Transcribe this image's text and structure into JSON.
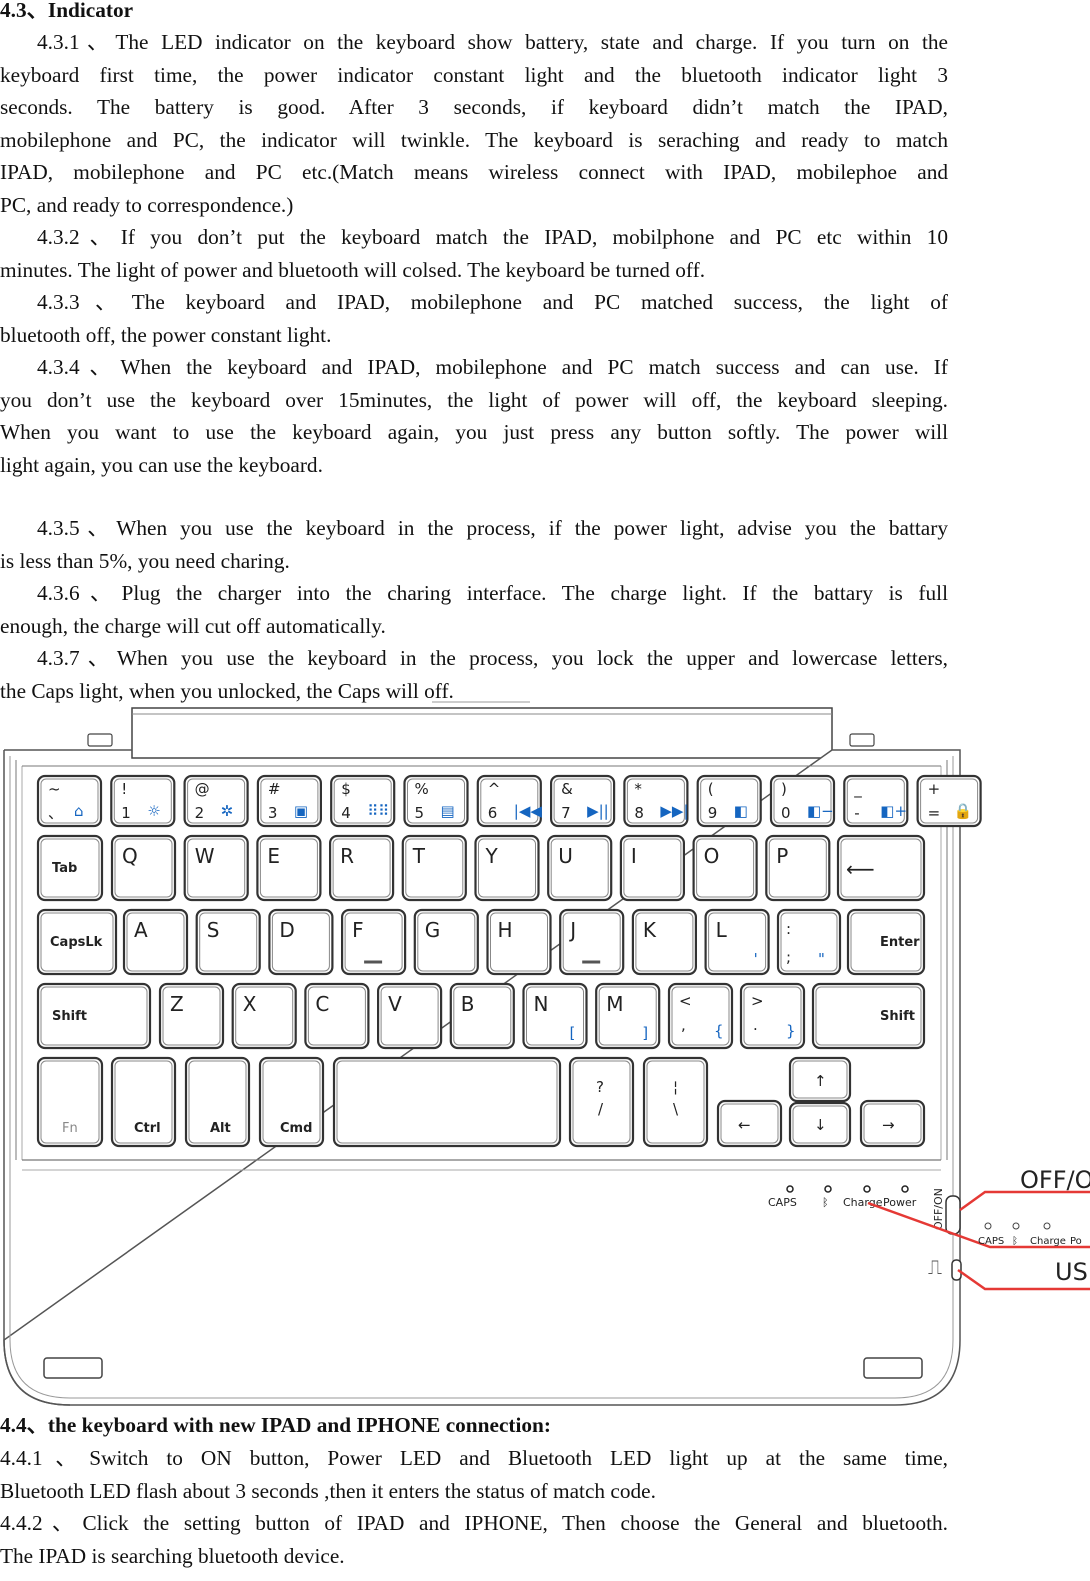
{
  "section_43": {
    "heading": "4.3、Indicator",
    "p431": [
      "4.3.1、The LED indicator on the keyboard show battery, state and charge. If you turn on the",
      "keyboard first time, the power indicator constant light and the bluetooth indicator light 3",
      "seconds. The battery is good. After 3 seconds, if keyboard didn’t match the IPAD,",
      "mobilephone and PC, the indicator will twinkle. The keyboard is seraching and ready to match",
      "IPAD, mobilephone and PC etc.(Match means wireless connect with IPAD, mobilephoe and",
      "PC, and ready to correspondence.)"
    ],
    "p432": [
      "4.3.2、If you don’t put the keyboard match the IPAD, mobilphone and PC etc within 10",
      "minutes. The light of power and bluetooth will colsed. The keyboard be turned off."
    ],
    "p433": [
      "4.3.3、The keyboard and IPAD, mobilephone and PC matched success, the light of",
      "bluetooth off, the power constant light."
    ],
    "p434": [
      "4.3.4、When the keyboard and IPAD, mobilephone and PC match success and can use. If",
      "you don’t use the keyboard over 15minutes, the light of power will off, the keyboard sleeping.",
      "When you want to use the keyboard again, you just press any button softly. The power will",
      "light again, you can use the keyboard."
    ],
    "p435": [
      "4.3.5、When you use the keyboard in the process, if the power light, advise you the battary",
      "is less than 5%, you need charing."
    ],
    "p436": [
      "4.3.6、Plug the charger into the charing interface. The charge light. If the battary is full",
      "enough, the charge will cut off automatically."
    ],
    "p437": [
      "4.3.7、When you use the keyboard in the process, you lock the upper and lowercase letters,",
      "the Caps light, when you unlocked, the Caps will off."
    ]
  },
  "figure": {
    "row1": [
      {
        "top": "~",
        "bottom": "、",
        "icon": "home-icon"
      },
      {
        "top": "!",
        "bottom": "1",
        "icon": "brightness-down-icon"
      },
      {
        "top": "@",
        "bottom": "2",
        "icon": "brightness-up-icon"
      },
      {
        "top": "#",
        "bottom": "3",
        "icon": "contacts-icon"
      },
      {
        "top": "$",
        "bottom": "4",
        "icon": "virtual-keyboard-icon"
      },
      {
        "top": "%",
        "bottom": "5",
        "icon": "search-icon"
      },
      {
        "top": "^",
        "bottom": "6",
        "icon": "previous-track-icon"
      },
      {
        "top": "&",
        "bottom": "7",
        "icon": "play-pause-icon"
      },
      {
        "top": "*",
        "bottom": "8",
        "icon": "next-track-icon"
      },
      {
        "top": "(",
        "bottom": "9",
        "icon": "mute-icon"
      },
      {
        "top": ")",
        "bottom": "0",
        "icon": "volume-down-icon"
      },
      {
        "top": "_",
        "bottom": "-",
        "icon": "volume-up-icon"
      },
      {
        "top": "+",
        "bottom": "=",
        "icon": "lock-icon"
      }
    ],
    "row1_glyphs": {
      "home-icon": "⌂",
      "brightness-down-icon": "☼",
      "brightness-up-icon": "✲",
      "contacts-icon": "▣",
      "virtual-keyboard-icon": "⠿⠿",
      "search-icon": "▤",
      "previous-track-icon": "|◀◀",
      "play-pause-icon": "▶||",
      "next-track-icon": "▶▶|",
      "mute-icon": "◧",
      "volume-down-icon": "◧−",
      "volume-up-icon": "◧+",
      "lock-icon": "🔒"
    },
    "row2": {
      "tab": "Tab",
      "letters": [
        "Q",
        "W",
        "E",
        "R",
        "T",
        "Y",
        "U",
        "I",
        "O",
        "P"
      ],
      "backspace": "⟵"
    },
    "row3": {
      "caps": "CapsLk",
      "letters": [
        "A",
        "S",
        "D",
        "F",
        "G",
        "H",
        "J",
        "K",
        "L"
      ],
      "semi_top": ":",
      "semi_bottom": ";",
      "l_alt": "'",
      "semi_alt": "\"",
      "enter": "Enter"
    },
    "row4": {
      "shift_left": "Shift",
      "letters": [
        "Z",
        "X",
        "C",
        "V",
        "B",
        "N",
        "M"
      ],
      "n_alt": "[",
      "m_alt": "]",
      "comma_top": "<",
      "comma_bottom": ",",
      "comma_alt": "{",
      "period_top": ">",
      "period_bottom": ".",
      "period_alt": "}",
      "shift_right": "Shift"
    },
    "row5": {
      "fn": "Fn",
      "ctrl": "Ctrl",
      "alt": "Alt",
      "cmd": "Cmd",
      "slash_top": "?",
      "slash_bottom": "/",
      "pipe_top": "¦",
      "pipe_bottom": "\\",
      "left": "←",
      "up": "↑",
      "down": "↓",
      "right": "→"
    },
    "leds": {
      "caps": "CAPS",
      "bluetooth": "ᛒ",
      "charge": "Charge",
      "power": "Power"
    },
    "switch_label": "OFF/ON",
    "callouts": {
      "switch": "OFF/ON",
      "usb": "USB",
      "caps": "CAPS",
      "bluetooth": "ᛒ",
      "charge": "Charge",
      "power": "Po"
    },
    "usb_symbol": "⎍",
    "accent_blue": "#1565c0",
    "callout_red": "#e53935"
  },
  "section_44": {
    "heading": "4.4、the keyboard with new IPAD and IPHONE connection:",
    "p441": [
      "4.4.1、Switch to ON button, Power LED and Bluetooth LED light up at the same time,",
      "Bluetooth LED flash about 3 seconds ,then it enters the status of match code."
    ],
    "p442": [
      "4.4.2、Click the setting button of IPAD and IPHONE, Then choose the General and bluetooth.",
      "The IPAD is searching bluetooth device."
    ]
  }
}
